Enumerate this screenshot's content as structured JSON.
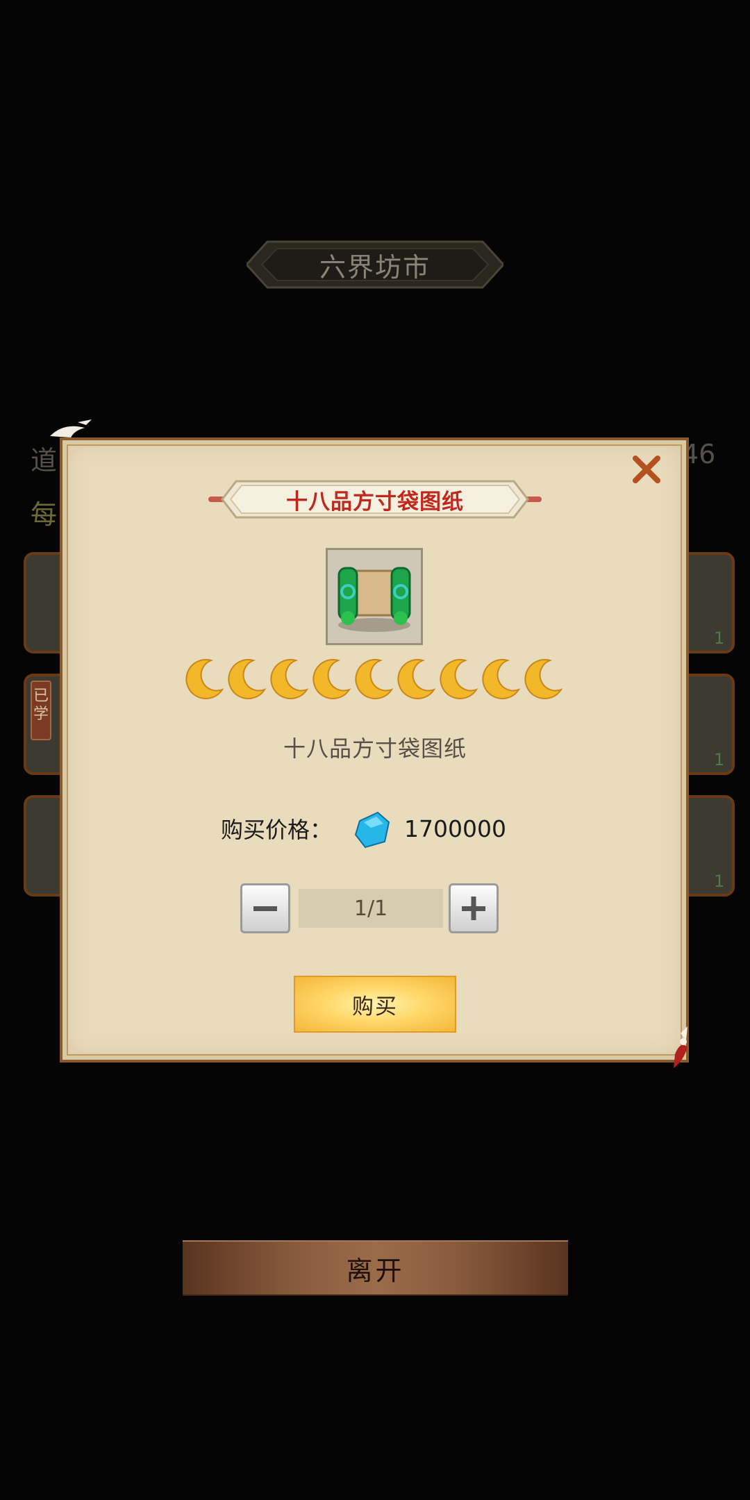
{
  "background": {
    "shop_title": "六界坊市",
    "left_label_1": "道",
    "left_label_2": "每",
    "right_value": "46",
    "learned_badge": "已学",
    "slot_counts": [
      "1",
      "1",
      "1"
    ],
    "leave_label": "离开"
  },
  "dialog": {
    "title": "十八品方寸袋图纸",
    "item_icon": "blueprint-scroll-icon",
    "star_count": 9,
    "star_icon": "crescent-moon-icon",
    "item_name": "十八品方寸袋图纸",
    "price_label": "购买价格：",
    "currency_icon": "blue-crystal-icon",
    "price_value": "1700000",
    "quantity": "1/1",
    "buy_label": "购买"
  },
  "colors": {
    "title_red": "#c0281e",
    "dialog_bg": "#e8dcbc",
    "buy_gold": "#ffd86a"
  }
}
